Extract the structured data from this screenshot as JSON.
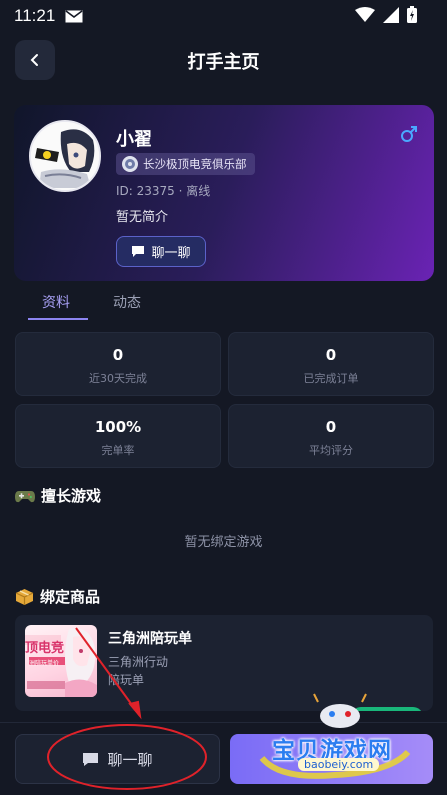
{
  "status_bar": {
    "time": "11:21",
    "icons": [
      "mail-icon",
      "wifi-icon",
      "signal-icon",
      "battery-icon"
    ]
  },
  "header": {
    "title": "打手主页",
    "back_icon": "chevron-left-icon"
  },
  "profile": {
    "name": "小翟",
    "gender": "male",
    "club": "长沙极顶电竞俱乐部",
    "meta": "ID: 23375 · 离线",
    "bio": "暂无简介",
    "chat_label": "聊一聊"
  },
  "tabs": [
    {
      "label": "资料",
      "active": true
    },
    {
      "label": "动态",
      "active": false
    }
  ],
  "stats": [
    {
      "value": "0",
      "label": "近30天完成"
    },
    {
      "value": "0",
      "label": "已完成订单"
    },
    {
      "value": "100%",
      "label": "完单率"
    },
    {
      "value": "0",
      "label": "平均评分"
    }
  ],
  "games_section": {
    "title": "擅长游戏",
    "empty_text": "暂无绑定游戏"
  },
  "products_section": {
    "title": "绑定商品",
    "items": [
      {
        "name": "三角洲陪玩单",
        "game": "三角洲行动",
        "type": "陪玩单",
        "thumb_text_1": "顶电竞",
        "thumb_text_2": "洲陪玩单价"
      }
    ]
  },
  "bottom_bar": {
    "chat_label": "聊一聊"
  },
  "watermark": {
    "text": "宝贝游戏网",
    "url": "baobeiy.com"
  },
  "colors": {
    "accent": "#8c84f0",
    "annotation_red": "#e0222a",
    "badge_green": "#19b77a"
  }
}
